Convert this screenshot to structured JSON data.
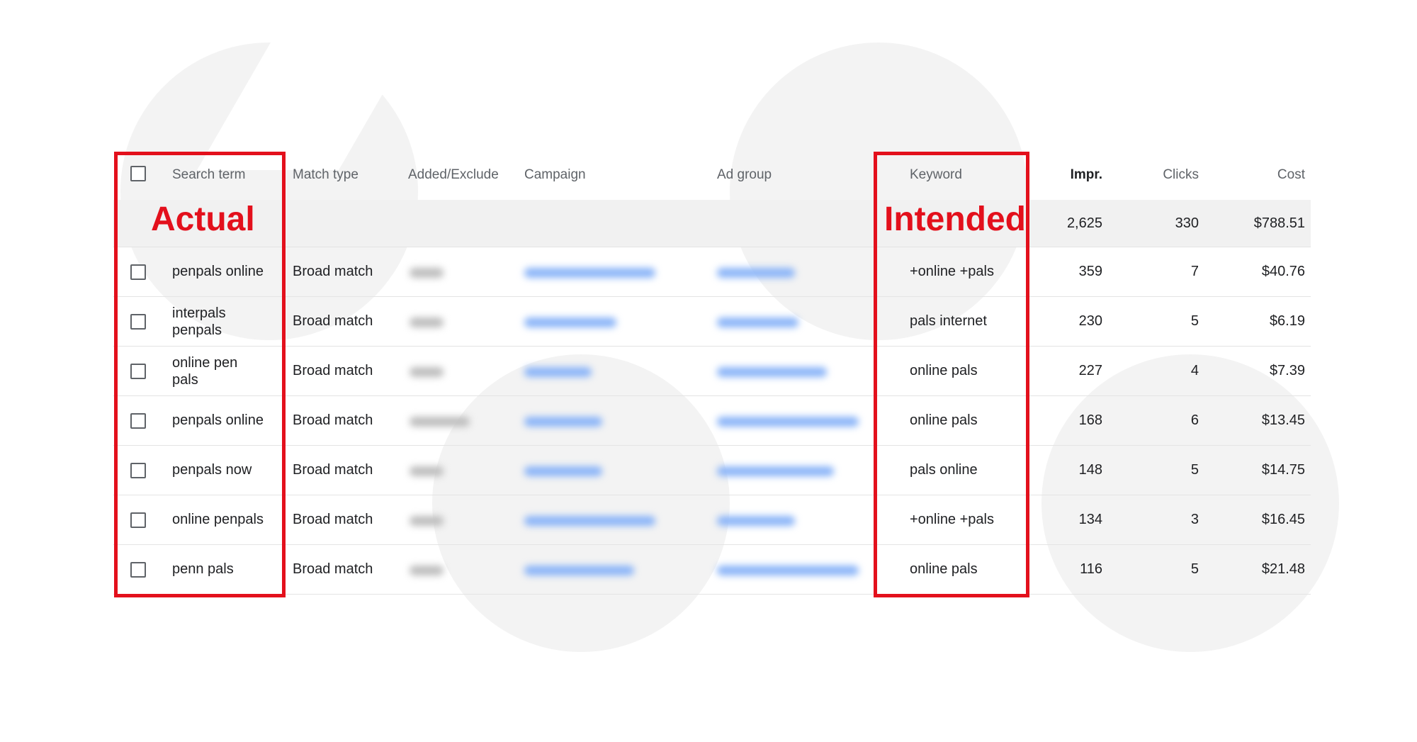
{
  "columns": {
    "search_term": "Search term",
    "match_type": "Match type",
    "added_excluded": "Added/Exclude",
    "campaign": "Campaign",
    "ad_group": "Ad group",
    "keyword": "Keyword",
    "impr": "Impr.",
    "clicks": "Clicks",
    "cost": "Cost"
  },
  "totals": {
    "impr": "2,625",
    "clicks": "330",
    "cost": "$788.51"
  },
  "annotations": {
    "actual": "Actual",
    "intended": "Intended"
  },
  "rows": [
    {
      "search_term": "penpals online",
      "match_type": "Broad match",
      "keyword": "+online +pals",
      "impr": "359",
      "clicks": "7",
      "cost": "$40.76"
    },
    {
      "search_term": "interpals penpals",
      "match_type": "Broad match",
      "keyword": "pals internet",
      "impr": "230",
      "clicks": "5",
      "cost": "$6.19"
    },
    {
      "search_term": "online pen pals",
      "match_type": "Broad match",
      "keyword": "online pals",
      "impr": "227",
      "clicks": "4",
      "cost": "$7.39"
    },
    {
      "search_term": "penpals online",
      "match_type": "Broad match",
      "keyword": "online pals",
      "impr": "168",
      "clicks": "6",
      "cost": "$13.45"
    },
    {
      "search_term": "penpals now",
      "match_type": "Broad match",
      "keyword": "pals online",
      "impr": "148",
      "clicks": "5",
      "cost": "$14.75"
    },
    {
      "search_term": "online penpals",
      "match_type": "Broad match",
      "keyword": "+online +pals",
      "impr": "134",
      "clicks": "3",
      "cost": "$16.45"
    },
    {
      "search_term": "penn pals",
      "match_type": "Broad match",
      "keyword": "online pals",
      "impr": "116",
      "clicks": "5",
      "cost": "$21.48"
    }
  ],
  "colors": {
    "annotation_red": "#e3101c",
    "link_blue": "#8ab4f8"
  }
}
